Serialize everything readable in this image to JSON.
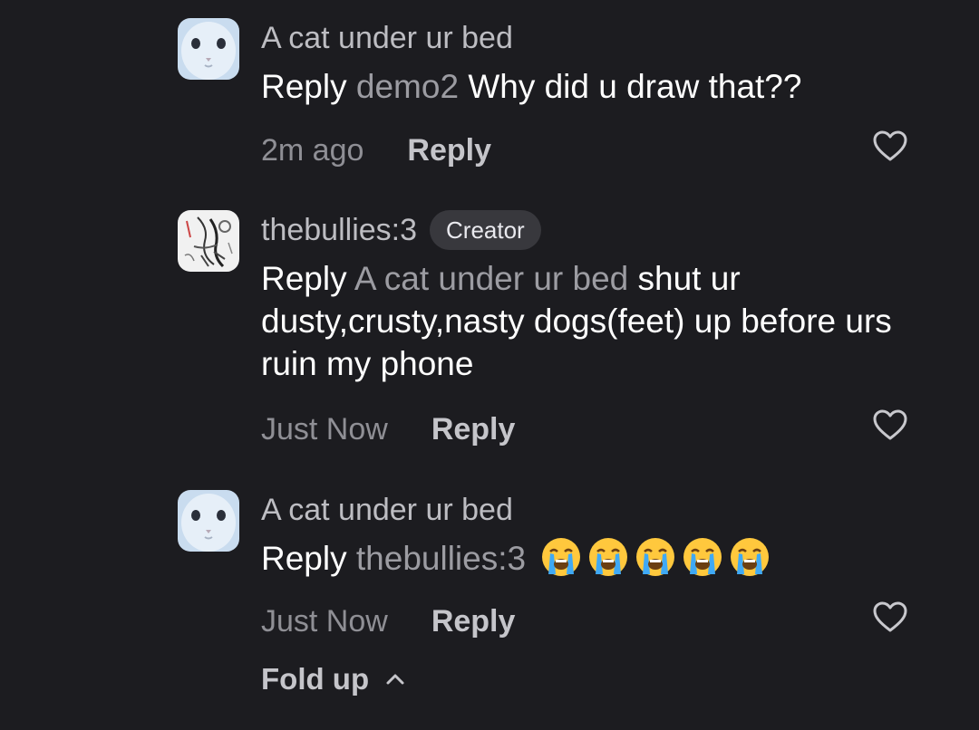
{
  "comments": [
    {
      "username": "A cat under ur bed",
      "reply_word": "Reply",
      "mention": "demo2",
      "text": "Why did u draw that??",
      "time": "2m ago",
      "reply_label": "Reply",
      "avatar_icon": "cat-face-avatar"
    },
    {
      "username": "thebullies:3",
      "badge": "Creator",
      "reply_word": "Reply",
      "mention": "A cat under ur bed",
      "text": "shut ur dusty,crusty,nasty dogs(feet) up before urs ruin my phone",
      "time": "Just Now",
      "reply_label": "Reply",
      "avatar_icon": "sketch-drawing-avatar"
    },
    {
      "username": "A cat under ur bed",
      "reply_word": "Reply",
      "mention": "thebullies:3",
      "emoji": "😭😭😭😭😭",
      "time": "Just Now",
      "reply_label": "Reply",
      "avatar_icon": "cat-face-avatar"
    }
  ],
  "fold_up_label": "Fold up",
  "colors": {
    "background": "#1c1c20",
    "text_primary": "#ffffff",
    "text_muted": "#9c9ca2",
    "badge_bg": "#38383d"
  }
}
